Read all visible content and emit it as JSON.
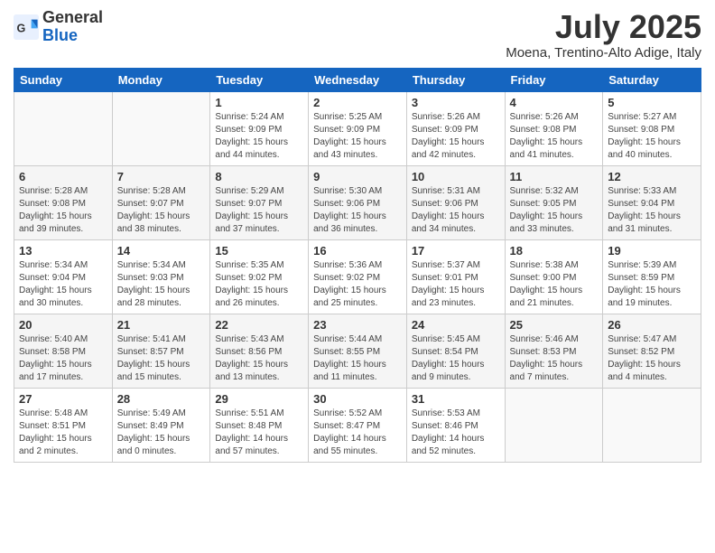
{
  "header": {
    "logo": {
      "general": "General",
      "blue": "Blue"
    },
    "title": "July 2025",
    "subtitle": "Moena, Trentino-Alto Adige, Italy"
  },
  "weekdays": [
    "Sunday",
    "Monday",
    "Tuesday",
    "Wednesday",
    "Thursday",
    "Friday",
    "Saturday"
  ],
  "weeks": [
    [
      {
        "day": "",
        "sunrise": "",
        "sunset": "",
        "daylight": ""
      },
      {
        "day": "",
        "sunrise": "",
        "sunset": "",
        "daylight": ""
      },
      {
        "day": "1",
        "sunrise": "Sunrise: 5:24 AM",
        "sunset": "Sunset: 9:09 PM",
        "daylight": "Daylight: 15 hours and 44 minutes."
      },
      {
        "day": "2",
        "sunrise": "Sunrise: 5:25 AM",
        "sunset": "Sunset: 9:09 PM",
        "daylight": "Daylight: 15 hours and 43 minutes."
      },
      {
        "day": "3",
        "sunrise": "Sunrise: 5:26 AM",
        "sunset": "Sunset: 9:09 PM",
        "daylight": "Daylight: 15 hours and 42 minutes."
      },
      {
        "day": "4",
        "sunrise": "Sunrise: 5:26 AM",
        "sunset": "Sunset: 9:08 PM",
        "daylight": "Daylight: 15 hours and 41 minutes."
      },
      {
        "day": "5",
        "sunrise": "Sunrise: 5:27 AM",
        "sunset": "Sunset: 9:08 PM",
        "daylight": "Daylight: 15 hours and 40 minutes."
      }
    ],
    [
      {
        "day": "6",
        "sunrise": "Sunrise: 5:28 AM",
        "sunset": "Sunset: 9:08 PM",
        "daylight": "Daylight: 15 hours and 39 minutes."
      },
      {
        "day": "7",
        "sunrise": "Sunrise: 5:28 AM",
        "sunset": "Sunset: 9:07 PM",
        "daylight": "Daylight: 15 hours and 38 minutes."
      },
      {
        "day": "8",
        "sunrise": "Sunrise: 5:29 AM",
        "sunset": "Sunset: 9:07 PM",
        "daylight": "Daylight: 15 hours and 37 minutes."
      },
      {
        "day": "9",
        "sunrise": "Sunrise: 5:30 AM",
        "sunset": "Sunset: 9:06 PM",
        "daylight": "Daylight: 15 hours and 36 minutes."
      },
      {
        "day": "10",
        "sunrise": "Sunrise: 5:31 AM",
        "sunset": "Sunset: 9:06 PM",
        "daylight": "Daylight: 15 hours and 34 minutes."
      },
      {
        "day": "11",
        "sunrise": "Sunrise: 5:32 AM",
        "sunset": "Sunset: 9:05 PM",
        "daylight": "Daylight: 15 hours and 33 minutes."
      },
      {
        "day": "12",
        "sunrise": "Sunrise: 5:33 AM",
        "sunset": "Sunset: 9:04 PM",
        "daylight": "Daylight: 15 hours and 31 minutes."
      }
    ],
    [
      {
        "day": "13",
        "sunrise": "Sunrise: 5:34 AM",
        "sunset": "Sunset: 9:04 PM",
        "daylight": "Daylight: 15 hours and 30 minutes."
      },
      {
        "day": "14",
        "sunrise": "Sunrise: 5:34 AM",
        "sunset": "Sunset: 9:03 PM",
        "daylight": "Daylight: 15 hours and 28 minutes."
      },
      {
        "day": "15",
        "sunrise": "Sunrise: 5:35 AM",
        "sunset": "Sunset: 9:02 PM",
        "daylight": "Daylight: 15 hours and 26 minutes."
      },
      {
        "day": "16",
        "sunrise": "Sunrise: 5:36 AM",
        "sunset": "Sunset: 9:02 PM",
        "daylight": "Daylight: 15 hours and 25 minutes."
      },
      {
        "day": "17",
        "sunrise": "Sunrise: 5:37 AM",
        "sunset": "Sunset: 9:01 PM",
        "daylight": "Daylight: 15 hours and 23 minutes."
      },
      {
        "day": "18",
        "sunrise": "Sunrise: 5:38 AM",
        "sunset": "Sunset: 9:00 PM",
        "daylight": "Daylight: 15 hours and 21 minutes."
      },
      {
        "day": "19",
        "sunrise": "Sunrise: 5:39 AM",
        "sunset": "Sunset: 8:59 PM",
        "daylight": "Daylight: 15 hours and 19 minutes."
      }
    ],
    [
      {
        "day": "20",
        "sunrise": "Sunrise: 5:40 AM",
        "sunset": "Sunset: 8:58 PM",
        "daylight": "Daylight: 15 hours and 17 minutes."
      },
      {
        "day": "21",
        "sunrise": "Sunrise: 5:41 AM",
        "sunset": "Sunset: 8:57 PM",
        "daylight": "Daylight: 15 hours and 15 minutes."
      },
      {
        "day": "22",
        "sunrise": "Sunrise: 5:43 AM",
        "sunset": "Sunset: 8:56 PM",
        "daylight": "Daylight: 15 hours and 13 minutes."
      },
      {
        "day": "23",
        "sunrise": "Sunrise: 5:44 AM",
        "sunset": "Sunset: 8:55 PM",
        "daylight": "Daylight: 15 hours and 11 minutes."
      },
      {
        "day": "24",
        "sunrise": "Sunrise: 5:45 AM",
        "sunset": "Sunset: 8:54 PM",
        "daylight": "Daylight: 15 hours and 9 minutes."
      },
      {
        "day": "25",
        "sunrise": "Sunrise: 5:46 AM",
        "sunset": "Sunset: 8:53 PM",
        "daylight": "Daylight: 15 hours and 7 minutes."
      },
      {
        "day": "26",
        "sunrise": "Sunrise: 5:47 AM",
        "sunset": "Sunset: 8:52 PM",
        "daylight": "Daylight: 15 hours and 4 minutes."
      }
    ],
    [
      {
        "day": "27",
        "sunrise": "Sunrise: 5:48 AM",
        "sunset": "Sunset: 8:51 PM",
        "daylight": "Daylight: 15 hours and 2 minutes."
      },
      {
        "day": "28",
        "sunrise": "Sunrise: 5:49 AM",
        "sunset": "Sunset: 8:49 PM",
        "daylight": "Daylight: 15 hours and 0 minutes."
      },
      {
        "day": "29",
        "sunrise": "Sunrise: 5:51 AM",
        "sunset": "Sunset: 8:48 PM",
        "daylight": "Daylight: 14 hours and 57 minutes."
      },
      {
        "day": "30",
        "sunrise": "Sunrise: 5:52 AM",
        "sunset": "Sunset: 8:47 PM",
        "daylight": "Daylight: 14 hours and 55 minutes."
      },
      {
        "day": "31",
        "sunrise": "Sunrise: 5:53 AM",
        "sunset": "Sunset: 8:46 PM",
        "daylight": "Daylight: 14 hours and 52 minutes."
      },
      {
        "day": "",
        "sunrise": "",
        "sunset": "",
        "daylight": ""
      },
      {
        "day": "",
        "sunrise": "",
        "sunset": "",
        "daylight": ""
      }
    ]
  ]
}
